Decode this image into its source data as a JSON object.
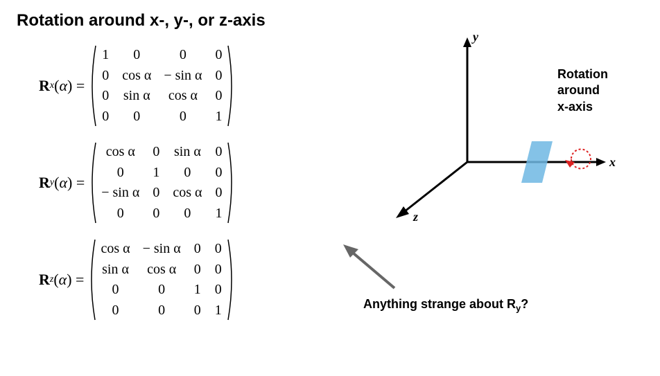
{
  "title": "Rotation around x-, y-, or z-axis",
  "matrices": {
    "rx": {
      "label_bold": "R",
      "label_sub": "x",
      "alpha": "α",
      "cells": [
        "1",
        "0",
        "0",
        "0",
        "0",
        "cos α",
        "− sin α",
        "0",
        "0",
        "sin α",
        "cos α",
        "0",
        "0",
        "0",
        "0",
        "1"
      ]
    },
    "ry": {
      "label_bold": "R",
      "label_sub": "y",
      "alpha": "α",
      "cells": [
        "cos α",
        "0",
        "sin α",
        "0",
        "0",
        "1",
        "0",
        "0",
        "− sin α",
        "0",
        "cos α",
        "0",
        "0",
        "0",
        "0",
        "1"
      ]
    },
    "rz": {
      "label_bold": "R",
      "label_sub": "z",
      "alpha": "α",
      "cells": [
        "cos α",
        "− sin α",
        "0",
        "0",
        "sin α",
        "cos α",
        "0",
        "0",
        "0",
        "0",
        "1",
        "0",
        "0",
        "0",
        "0",
        "1"
      ]
    }
  },
  "diagram": {
    "x_label": "x",
    "y_label": "y",
    "z_label": "z",
    "rotation_label_l1": "Rotation",
    "rotation_label_l2": "around",
    "rotation_label_l3": "x-axis"
  },
  "question": {
    "prefix": "Anything strange about R",
    "sub": "y",
    "suffix": "?"
  }
}
